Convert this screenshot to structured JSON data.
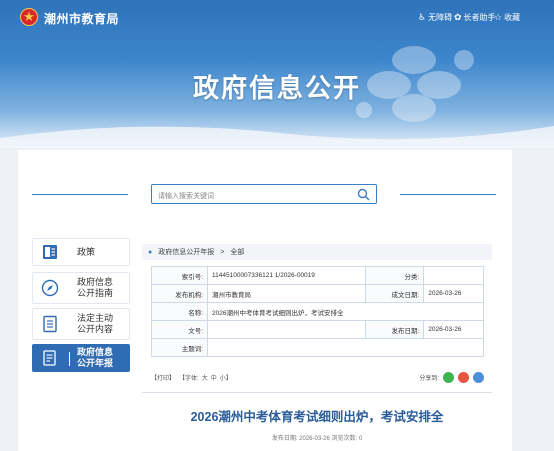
{
  "header": {
    "site_title": "潮州市教育局",
    "tools": [
      {
        "label": "无障碍",
        "icon": "accessibility-icon"
      },
      {
        "label": "长者助手",
        "icon": "elder-assist-icon"
      },
      {
        "label": "收藏",
        "icon": "star-icon"
      }
    ]
  },
  "banner": {
    "title": "政府信息公开"
  },
  "search": {
    "placeholder": "请输入搜索关键词"
  },
  "sidebar": {
    "items": [
      {
        "label": "政策",
        "icon": "document-icon",
        "active": false
      },
      {
        "label": "政府信息\n公开指南",
        "icon": "compass-icon",
        "active": false
      },
      {
        "label": "法定主动\n公开内容",
        "icon": "list-icon",
        "active": false
      },
      {
        "label": "政府信息\n公开年报",
        "icon": "report-icon",
        "active": true
      }
    ]
  },
  "breadcrumb": {
    "items": [
      "政府信息公开年报",
      ">",
      "全部"
    ]
  },
  "meta": {
    "index_label": "索引号:",
    "index_value": "11445100007336121 1/2026-00019",
    "category_label": "分类:",
    "category_value": "",
    "publisher_label": "发布机构:",
    "publisher_value": "潮州市教育局",
    "created_label": "成文日期:",
    "created_value": "2026-03-26",
    "name_label": "名称:",
    "name_value": "2026潮州中考体育考试细则出炉，考试安排全",
    "docno_label": "文号:",
    "docno_value": "",
    "pubdate_label": "发布日期:",
    "pubdate_value": "2026-03-26",
    "subject_label": "主题词:",
    "subject_value": ""
  },
  "toolbar": {
    "print": "【打印】",
    "font_prefix": "【字体:",
    "font_large": "大",
    "font_medium": "中",
    "font_small": "小",
    "font_suffix": "】",
    "share_label": "分享到:",
    "share_colors": [
      "#3fb34f",
      "#e8553e",
      "#4a90d9"
    ]
  },
  "article": {
    "title": "2026潮州中考体育考试细则出炉，考试安排全",
    "meta": "发布日期: 2026-03-26  浏览次数: 0"
  },
  "colors": {
    "primary": "#2f6cb3",
    "title_blue": "#2b5c9a"
  }
}
